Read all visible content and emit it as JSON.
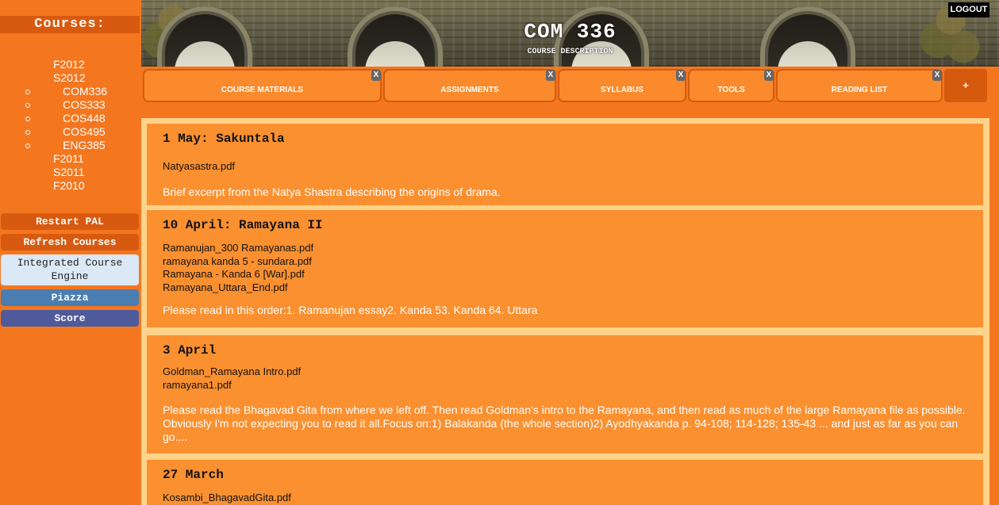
{
  "sidebar": {
    "heading": "Courses:",
    "terms_top": [
      "F2012",
      "S2012"
    ],
    "courses": [
      "COM336",
      "COS333",
      "COS448",
      "COS495",
      "ENG385"
    ],
    "terms_bottom": [
      "F2011",
      "S2011",
      "F2010"
    ],
    "buttons": {
      "restart": "Restart PAL",
      "refresh": "Refresh Courses",
      "ice_line1": "Integrated Course",
      "ice_line2": "Engine",
      "piazza": "Piazza",
      "score": "Score"
    }
  },
  "banner": {
    "title": "COM 336",
    "subtitle": "COURSE DESCRIPTION",
    "logout": "LOGOUT"
  },
  "tabs": [
    {
      "label": "COURSE MATERIALS",
      "close": "X"
    },
    {
      "label": "ASSIGNMENTS",
      "close": "X"
    },
    {
      "label": "SYLLABUS",
      "close": "X"
    },
    {
      "label": "TOOLS",
      "close": "X"
    },
    {
      "label": "READING LIST",
      "close": "X"
    }
  ],
  "add_tab": "+",
  "entries": [
    {
      "title": "1 May: Sakuntala",
      "files": [
        "Natyasastra.pdf"
      ],
      "description": "Brief excerpt from the Natya Shastra describing the origins of drama."
    },
    {
      "title": "10 April: Ramayana II",
      "files": [
        "Ramanujan_300 Ramayanas.pdf",
        "ramayana kanda 5 - sundara.pdf",
        "Ramayana - Kanda 6 [War].pdf",
        "Ramayana_Uttara_End.pdf"
      ],
      "description": "Please read in this order:1. Ramanujan essay2. Kanda 53. Kanda 64. Uttara"
    },
    {
      "title": "3 April",
      "files": [
        "Goldman_Ramayana Intro.pdf",
        "ramayana1.pdf"
      ],
      "description": "Please read the Bhagavad Gita from where we left off. Then read Goldman's intro to the Ramayana, and then read as much of the large Ramayana file as possible. Obviously I'm not expecting you to read it all.Focus on:1) Balakanda (the whole section)2) Ayodhyakanda p. 94-108; 114-128; 135-43 ... and just as far as you can go...."
    },
    {
      "title": "27 March",
      "files": [
        "Kosambi_BhagavadGita.pdf"
      ],
      "description": ""
    }
  ]
}
